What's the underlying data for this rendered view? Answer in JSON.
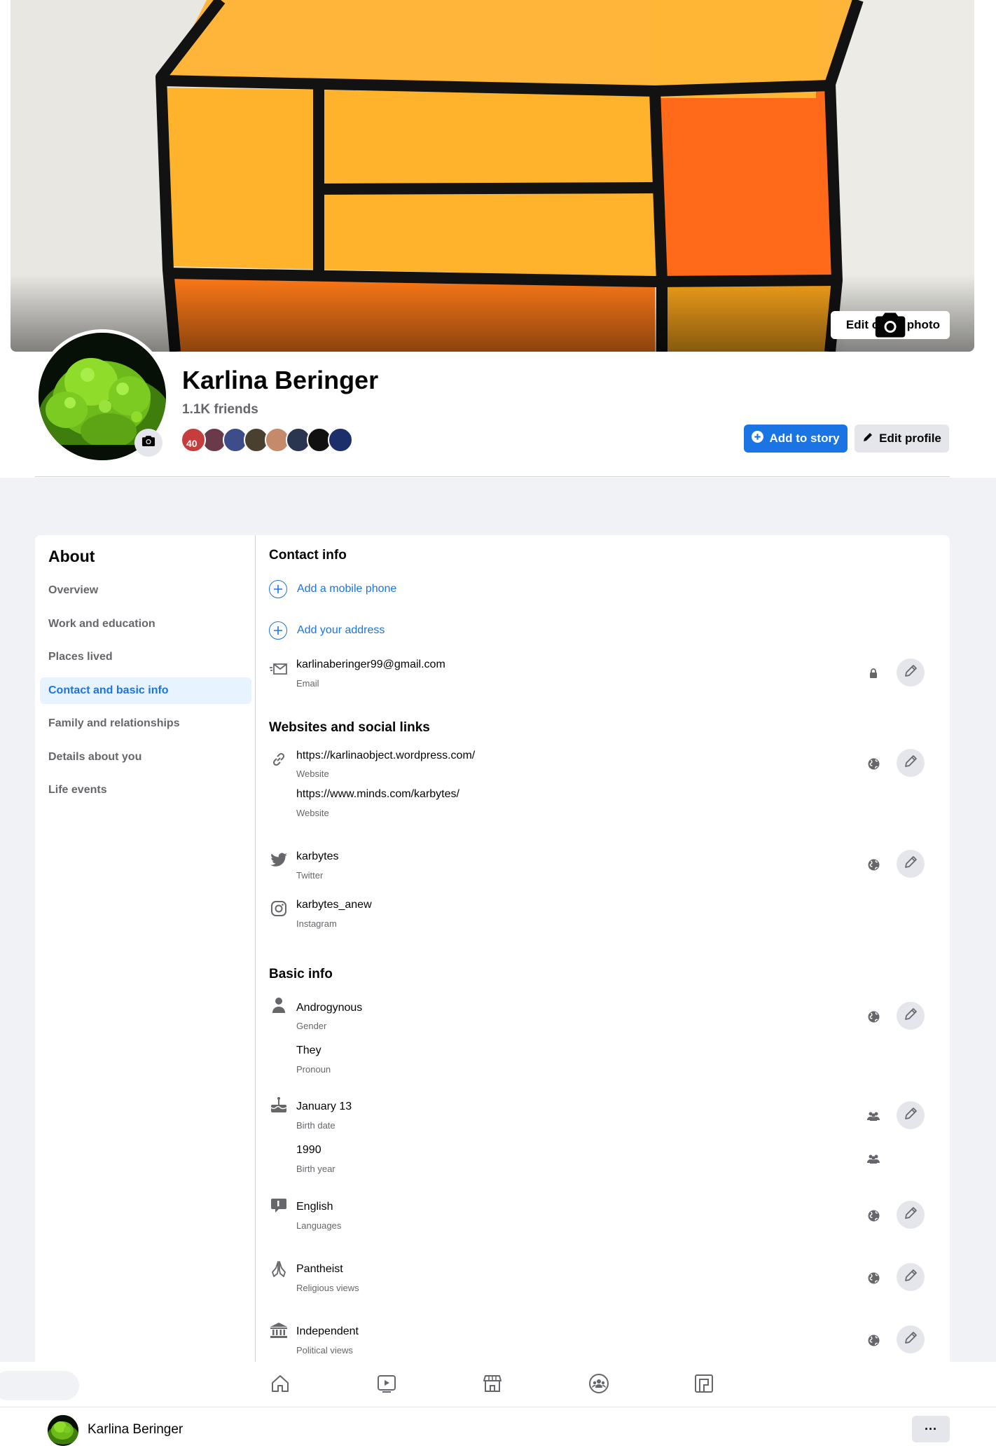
{
  "profile": {
    "name": "Karlina Beringer",
    "friends_count": "1.1K friends"
  },
  "cover": {
    "edit_cover_label": "Edit cover photo",
    "friend_face_number": "40"
  },
  "actions": {
    "add_to_story": "Add to story",
    "edit_profile": "Edit profile"
  },
  "about": {
    "title": "About",
    "nav": [
      "Overview",
      "Work and education",
      "Places lived",
      "Contact and basic info",
      "Family and relationships",
      "Details about you",
      "Life events"
    ],
    "active_nav": "Contact and basic info"
  },
  "contact_info": {
    "title": "Contact info",
    "add_phone": "Add a mobile phone",
    "add_address": "Add your address",
    "email": {
      "value": "karlinaberinger99@gmail.com",
      "label": "Email",
      "audience": "lock-icon"
    }
  },
  "websites": {
    "title": "Websites and social links",
    "items": [
      {
        "value": "https://karlinaobject.wordpress.com/",
        "label": "Website"
      },
      {
        "value": "https://www.minds.com/karbytes/",
        "label": "Website"
      },
      {
        "value": "karbytes",
        "label": "Twitter"
      },
      {
        "value": "karbytes_anew",
        "label": "Instagram"
      }
    ]
  },
  "basic_info": {
    "title": "Basic info",
    "items": [
      {
        "value": "Androgynous",
        "label": "Gender"
      },
      {
        "value": "They",
        "label": "Pronoun"
      },
      {
        "value": "January 13",
        "label": "Birth date"
      },
      {
        "value": "1990",
        "label": "Birth year"
      },
      {
        "value": "English",
        "label": "Languages"
      },
      {
        "value": "Pantheist",
        "label": "Religious views"
      },
      {
        "value": "Independent",
        "label": "Political views"
      }
    ]
  },
  "bottom_bar": {
    "name": "Karlina Beringer",
    "more_label": "···"
  },
  "colors": {
    "accent": "#1b74e4",
    "page_bg": "#f0f2f5",
    "secondary_text": "#65676b",
    "active_nav_bg": "#e7f3ff"
  }
}
